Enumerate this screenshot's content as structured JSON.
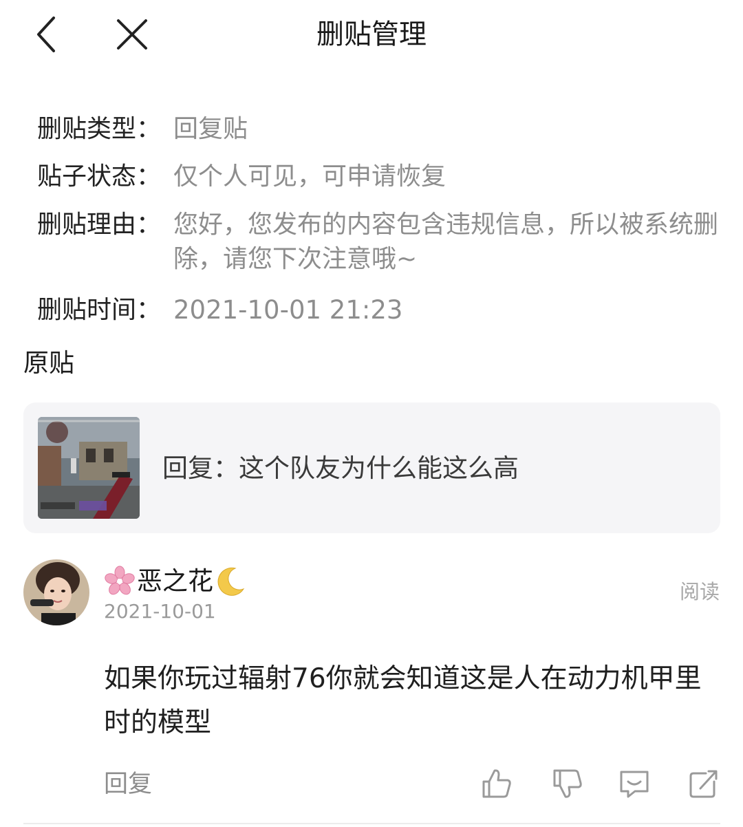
{
  "header": {
    "title": "删贴管理",
    "back_icon": "back-chevron-icon",
    "close_icon": "close-icon"
  },
  "info": {
    "type": {
      "label": "删贴类型：",
      "value": "回复贴"
    },
    "status": {
      "label": "贴子状态：",
      "value": "仅个人可见，可申请恢复"
    },
    "reason": {
      "label": "删贴理由：",
      "value": "您好，您发布的内容包含违规信息，所以被系统删除，请您下次注意哦~"
    },
    "time": {
      "label": "删贴时间：",
      "value": "2021-10-01 21:23"
    }
  },
  "original": {
    "section_title": "原贴",
    "text": "回复：这个队友为什么能这么高",
    "thumbnail_icon": "game-screenshot-thumbnail"
  },
  "comment": {
    "username": "恶之花",
    "name_prefix_icon": "cherry-blossom-icon",
    "name_suffix_icon": "crescent-moon-icon",
    "date": "2021-10-01",
    "read_label": "阅读",
    "body": "如果你玩过辐射76你就会知道这是人在动力机甲里时的模型"
  },
  "actions": {
    "reply_label": "回复",
    "icons": [
      "thumbs-up-icon",
      "thumbs-down-icon",
      "comment-icon",
      "share-icon"
    ]
  },
  "colors": {
    "card_background": "#f5f5f7",
    "muted_text": "#8d8d8d",
    "icon_gray": "#9a9a9a"
  }
}
